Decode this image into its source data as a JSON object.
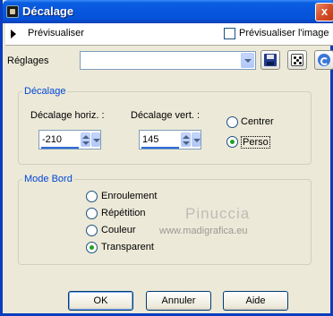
{
  "window": {
    "title": "Décalage",
    "close_glyph": "x"
  },
  "preview": {
    "label": "Prévisualiser",
    "checkbox_label": "Prévisualiser l'image",
    "checked": false
  },
  "presets": {
    "label": "Réglages",
    "value": ""
  },
  "offset_group": {
    "title": "Décalage",
    "horizontal": {
      "label": "Décalage horiz. :",
      "value": "-210"
    },
    "vertical": {
      "label": "Décalage vert. :",
      "value": "145"
    },
    "options": [
      {
        "label": "Centrer",
        "selected": false
      },
      {
        "label": "Perso",
        "selected": true
      }
    ]
  },
  "edge_group": {
    "title": "Mode Bord",
    "options": [
      {
        "label": "Enroulement",
        "selected": false
      },
      {
        "label": "Répétition",
        "selected": false
      },
      {
        "label": "Couleur",
        "selected": false
      },
      {
        "label": "Transparent",
        "selected": true
      }
    ]
  },
  "watermark": {
    "name": "Pinuccia",
    "site": "www.madigrafica.eu"
  },
  "buttons": {
    "ok": "OK",
    "cancel": "Annuler",
    "help": "Aide"
  },
  "icons": {
    "app": "app-icon",
    "expand": "triangle-right-icon",
    "save": "floppy-disk-icon",
    "random": "dice-icon",
    "reset": "reset-icon"
  },
  "colors": {
    "titlebar": "#0855dd",
    "group_title": "#0046d5",
    "radio_on": "#21a121"
  }
}
